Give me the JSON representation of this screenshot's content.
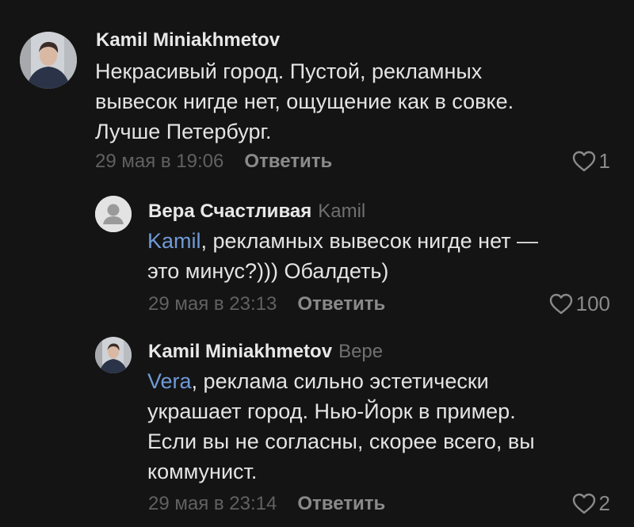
{
  "comments": [
    {
      "author": "Kamil Miniakhmetov",
      "reply_to": "",
      "lines": [
        "Некрасивый город. Пустой, рекламных",
        "вывесок нигде нет, ощущение как в совке.",
        "Лучше Петербург."
      ],
      "date": "29 мая в 19:06",
      "reply_label": "Ответить",
      "likes": "1"
    },
    {
      "author": "Вера Счастливая",
      "reply_to": "Kamil",
      "mention": "Kamil",
      "line1_rest": ", рекламных вывесок нигде нет —",
      "line2": "это минус?))) Обалдеть)",
      "date": "29 мая в 23:13",
      "reply_label": "Ответить",
      "likes": "100"
    },
    {
      "author": "Kamil Miniakhmetov",
      "reply_to": "Вере",
      "mention": "Vera",
      "line1_rest": ", реклама сильно эстетически",
      "line2": "украшает город. Нью-Йорк в пример.",
      "line3": "Если вы не согласны, скорее всего, вы",
      "line4": "коммунист.",
      "date": "29 мая в 23:14",
      "reply_label": "Ответить",
      "likes": "2"
    }
  ],
  "icons": {
    "heart": "heart-icon",
    "default_avatar": "user-placeholder-icon"
  },
  "colors": {
    "background": "#141414",
    "mention": "#6f9ad6",
    "muted": "#616161"
  }
}
